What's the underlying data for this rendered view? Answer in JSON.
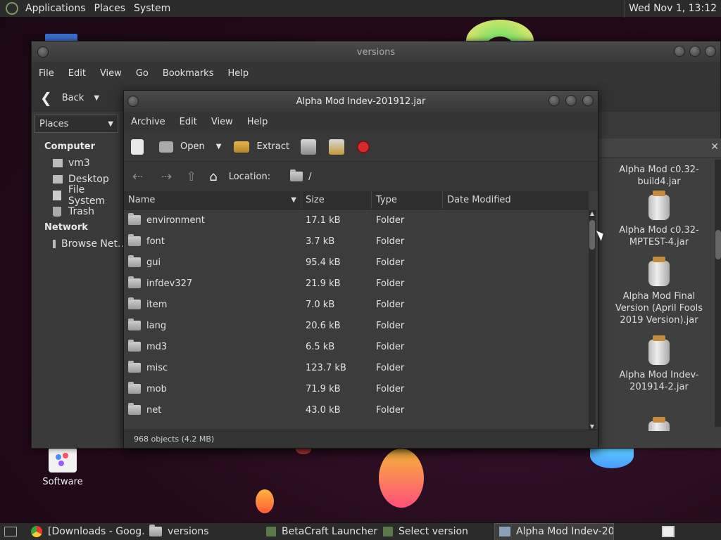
{
  "topbar": {
    "menus": [
      "Applications",
      "Places",
      "System"
    ],
    "clock": "Wed Nov 1, 13:12"
  },
  "desktop": {
    "software_label": "Software"
  },
  "versions_window": {
    "title": "versions",
    "menus": [
      "File",
      "Edit",
      "View",
      "Go",
      "Bookmarks",
      "Help"
    ],
    "back_label": "Back",
    "places_label": "Places",
    "sidebar": {
      "computer_header": "Computer",
      "computer_items": [
        "vm3",
        "Desktop",
        "File System",
        "Trash"
      ],
      "network_header": "Network",
      "network_items": [
        "Browse Net..."
      ]
    },
    "right_panel_files": [
      "Alpha Mod c0.32-build4.jar",
      "Alpha Mod c0.32-MPTEST-4.jar",
      "Alpha Mod Final Version (April Fools 2019 Version).jar",
      "Alpha Mod Indev-201914-2.jar"
    ]
  },
  "archive_window": {
    "title": "Alpha Mod Indev-201912.jar",
    "menus": [
      "Archive",
      "Edit",
      "View",
      "Help"
    ],
    "toolbar": {
      "open_label": "Open",
      "extract_label": "Extract"
    },
    "location_label": "Location:",
    "location_path": "/",
    "columns": [
      "Name",
      "Size",
      "Type",
      "Date Modified"
    ],
    "rows": [
      {
        "name": "environment",
        "size": "17.1 kB",
        "type": "Folder"
      },
      {
        "name": "font",
        "size": "3.7 kB",
        "type": "Folder"
      },
      {
        "name": "gui",
        "size": "95.4 kB",
        "type": "Folder"
      },
      {
        "name": "infdev327",
        "size": "21.9 kB",
        "type": "Folder"
      },
      {
        "name": "item",
        "size": "7.0 kB",
        "type": "Folder"
      },
      {
        "name": "lang",
        "size": "20.6 kB",
        "type": "Folder"
      },
      {
        "name": "md3",
        "size": "6.5 kB",
        "type": "Folder"
      },
      {
        "name": "misc",
        "size": "123.7 kB",
        "type": "Folder"
      },
      {
        "name": "mob",
        "size": "71.9 kB",
        "type": "Folder"
      },
      {
        "name": "net",
        "size": "43.0 kB",
        "type": "Folder"
      }
    ],
    "status": "968 objects (4.2 MB)"
  },
  "taskbar": {
    "tasks": [
      "[Downloads - Goog...",
      "versions",
      "BetaCraft Launcher ...",
      "Select version",
      "Alpha Mod Indev-20..."
    ]
  }
}
